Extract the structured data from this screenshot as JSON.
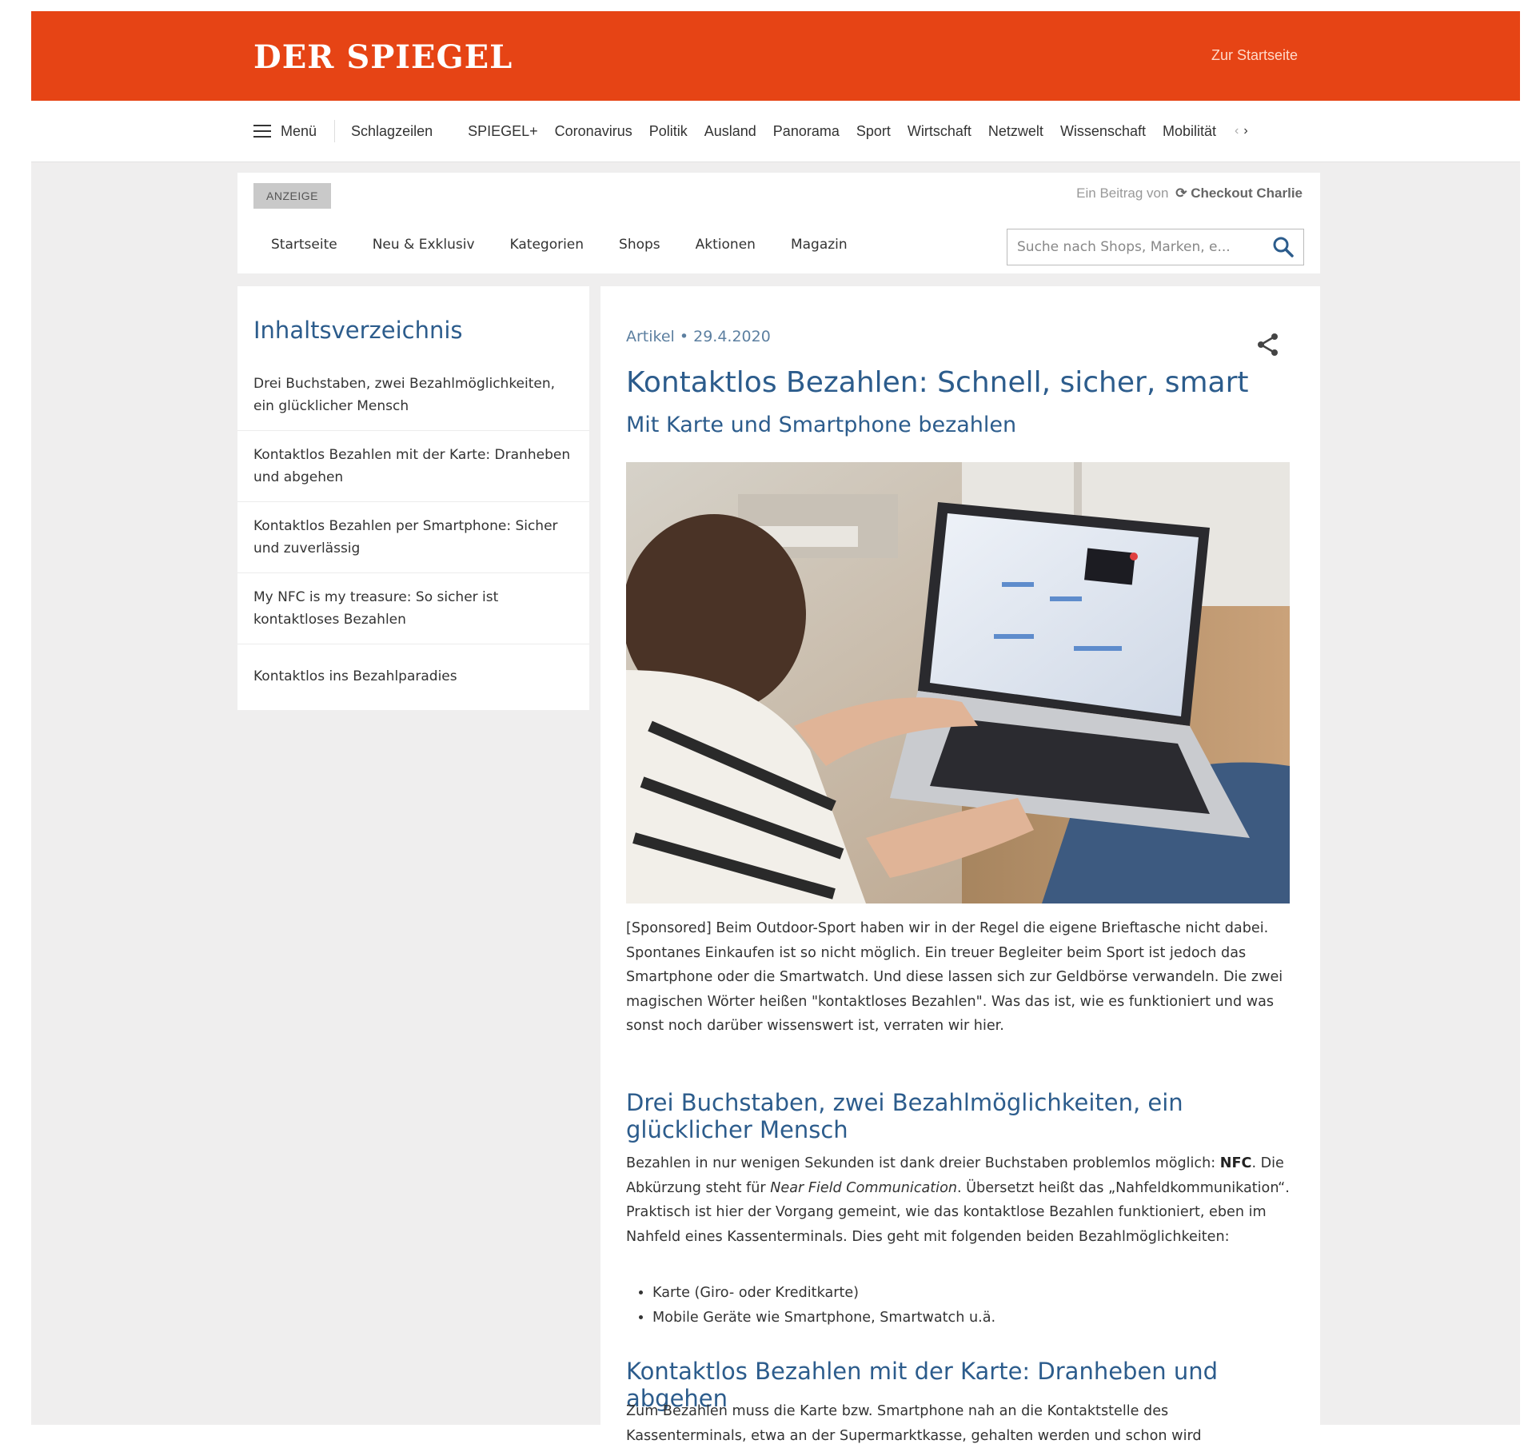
{
  "site": {
    "logo": "DER SPIEGEL",
    "home_link": "Zur Startseite",
    "brand_color": "#e64415"
  },
  "nav": {
    "menu_label": "Menü",
    "items": [
      "Schlagzeilen",
      "SPIEGEL+",
      "Coronavirus",
      "Politik",
      "Ausland",
      "Panorama",
      "Sport",
      "Wirtschaft",
      "Netzwelt",
      "Wissenschaft",
      "Mobilität"
    ],
    "scroll_icons": [
      "chevron-left-icon",
      "chevron-right-icon"
    ]
  },
  "ad_header": {
    "badge": "ANZEIGE",
    "sponsor_prefix": "Ein Beitrag von",
    "sponsor_name": "Checkout Charlie",
    "menu": [
      "Startseite",
      "Neu & Exklusiv",
      "Kategorien",
      "Shops",
      "Aktionen",
      "Magazin"
    ],
    "search_placeholder": "Suche nach Shops, Marken, e..."
  },
  "toc": {
    "title": "Inhaltsverzeichnis",
    "items": [
      "Drei Buchstaben, zwei Bezahlmöglichkeiten, ein glücklicher Mensch",
      "Kontaktlos Bezahlen mit der Karte: Dranheben und abgehen",
      "Kontaktlos Bezahlen per Smartphone: Sicher und zuverlässig",
      "My NFC is my treasure: So sicher ist kontaktloses Bezahlen",
      "Kontaktlos ins Bezahlparadies"
    ]
  },
  "article": {
    "meta": "Artikel • 29.4.2020",
    "headline": "Kontaktlos Bezahlen: Schnell, sicher, smart",
    "subheadline": "Mit Karte und Smartphone bezahlen",
    "intro": "[Sponsored] Beim Outdoor-Sport haben wir in der Regel die eigene Brieftasche nicht dabei. Spontanes Einkaufen ist so nicht möglich. Ein treuer Begleiter beim Sport ist jedoch das Smartphone oder die Smartwatch. Und diese lassen sich zur Geldbörse verwandeln. Die zwei magischen Wörter heißen \"kontaktloses Bezahlen\". Was das ist, wie es funktioniert und was sonst noch darüber wissenswert ist, verraten wir hier.",
    "section1_title": "Drei Buchstaben, zwei Bezahlmöglichkeiten, ein glücklicher Mensch",
    "section1_p_a": "Bezahlen in nur wenigen Sekunden ist dank dreier Buchstaben problemlos möglich: ",
    "section1_p_nfc": "NFC",
    "section1_p_b": ". Die Abkürzung steht für ",
    "section1_p_italic": "Near Field Communication",
    "section1_p_c": ". Übersetzt heißt das „Nahfeldkommunikation“. Praktisch ist hier der Vorgang gemeint, wie das kontaktlose Bezahlen funktioniert, eben im Nahfeld eines Kassenterminals. Dies geht mit folgenden beiden Bezahlmöglichkeiten:",
    "bullets": [
      "Karte (Giro- oder Kreditkarte)",
      "Mobile Geräte wie Smartphone, Smartwatch u.ä."
    ],
    "section2_title": "Kontaktlos Bezahlen mit der Karte: Dranheben und abgehen",
    "section2_p": "Zum Bezahlen muss die Karte bzw. Smartphone nah an die Kontaktstelle des Kassenterminals, etwa an der Supermarktkasse, gehalten werden und schon wird"
  },
  "colors": {
    "heading_blue": "#2c5c8c",
    "page_background": "#efeeee"
  }
}
